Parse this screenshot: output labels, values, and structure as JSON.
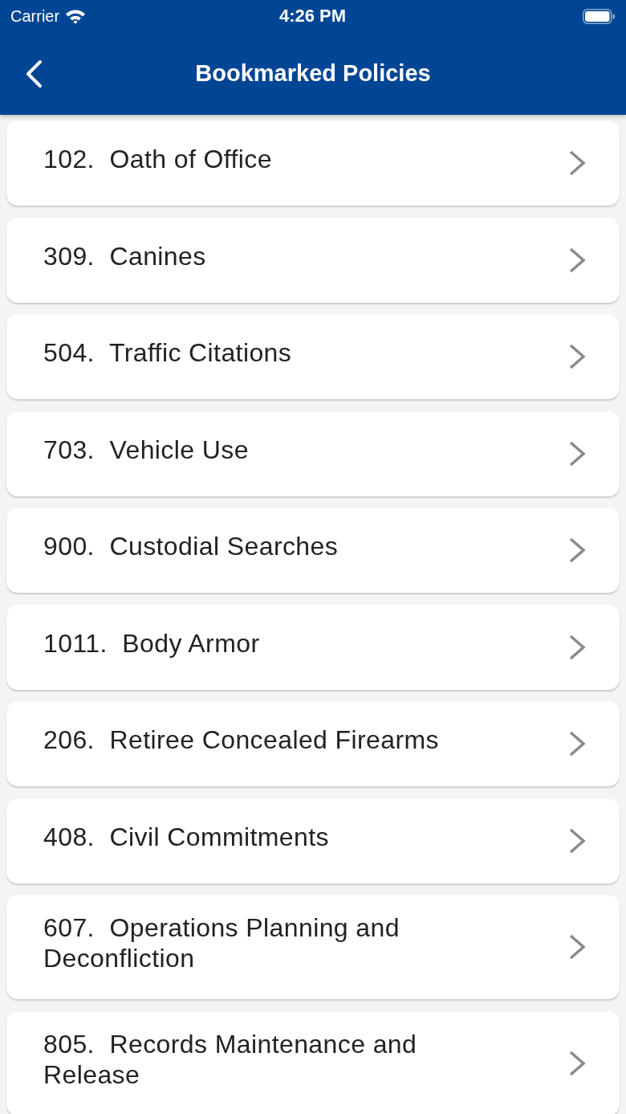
{
  "status_bar": {
    "carrier": "Carrier",
    "time": "4:26 PM"
  },
  "nav_bar": {
    "title": "Bookmarked Policies"
  },
  "policies": [
    {
      "label": "102.  Oath of Office"
    },
    {
      "label": "309.  Canines"
    },
    {
      "label": "504.  Traffic Citations"
    },
    {
      "label": "703.  Vehicle Use"
    },
    {
      "label": "900.  Custodial Searches"
    },
    {
      "label": "1011.  Body Armor"
    },
    {
      "label": "206.  Retiree Concealed Firearms"
    },
    {
      "label": "408.  Civil Commitments"
    },
    {
      "label": "607.  Operations Planning and Deconfliction"
    },
    {
      "label": "805.  Records Maintenance and Release"
    }
  ]
}
